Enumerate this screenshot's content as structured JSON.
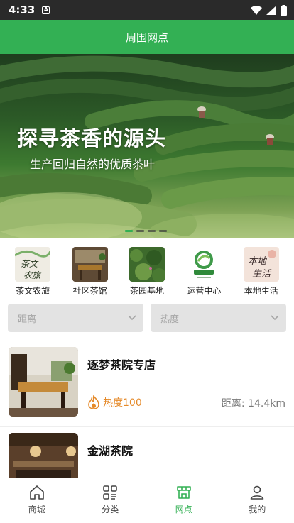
{
  "status_bar": {
    "time": "4:33",
    "notif": "A"
  },
  "header": {
    "title": "周围网点"
  },
  "banner": {
    "title": "探寻茶香的源头",
    "subtitle": "生产回归自然的优质茶叶",
    "slide_count": 4,
    "active_slide": 1
  },
  "categories": [
    {
      "label": "茶文农旅",
      "icon": "tea-culture-icon"
    },
    {
      "label": "社区茶馆",
      "icon": "teahouse-icon"
    },
    {
      "label": "茶园基地",
      "icon": "tea-garden-icon"
    },
    {
      "label": "运营中心",
      "icon": "operation-center-icon"
    },
    {
      "label": "本地生活",
      "icon": "local-life-icon"
    }
  ],
  "filters": [
    {
      "placeholder": "距离"
    },
    {
      "placeholder": "热度"
    }
  ],
  "stores": [
    {
      "name": "逐梦茶院专店",
      "heat": "热度100",
      "distance": "距离: 14.4km"
    },
    {
      "name": "金湖茶院"
    }
  ],
  "tabs": [
    {
      "label": "商城",
      "icon": "home-icon"
    },
    {
      "label": "分类",
      "icon": "category-icon"
    },
    {
      "label": "网点",
      "icon": "store-icon",
      "active": true
    },
    {
      "label": "我的",
      "icon": "profile-icon"
    }
  ],
  "colors": {
    "primary": "#33b054",
    "heat": "#e58a2a",
    "statusbar": "#2a2a2a"
  }
}
